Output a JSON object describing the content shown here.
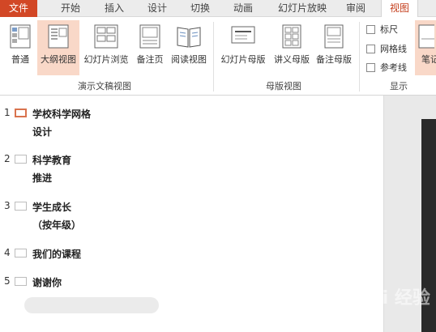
{
  "tabs": [
    "文件",
    "开始",
    "插入",
    "设计",
    "切换",
    "动画",
    "幻灯片放映",
    "审阅",
    "视图"
  ],
  "ribbon": {
    "presentation_views": {
      "group_label": "演示文稿视图",
      "buttons": [
        "普通",
        "大纲视图",
        "幻灯片浏览",
        "备注页",
        "阅读视图"
      ]
    },
    "master_views": {
      "group_label": "母版视图",
      "buttons": [
        "幻灯片母版",
        "讲义母版",
        "备注母版"
      ]
    },
    "show": {
      "group_label": "显示",
      "checkboxes": [
        "标尺",
        "网格线",
        "参考线"
      ]
    },
    "partial_button": "笔记"
  },
  "outline": [
    {
      "number": "1",
      "lines": [
        "学校科学网格",
        "设计"
      ]
    },
    {
      "number": "2",
      "lines": [
        "科学教育",
        "推进"
      ]
    },
    {
      "number": "3",
      "lines": [
        "学生成长",
        "（按年级）"
      ]
    },
    {
      "number": "4",
      "lines": [
        "我们的课程"
      ]
    },
    {
      "number": "5",
      "lines": [
        "谢谢你"
      ]
    }
  ],
  "watermark": "Bai 经验",
  "colors": {
    "accent": "#d24726",
    "selected_bg": "#f9d8c8",
    "current_slide_border": "#d9734e"
  }
}
